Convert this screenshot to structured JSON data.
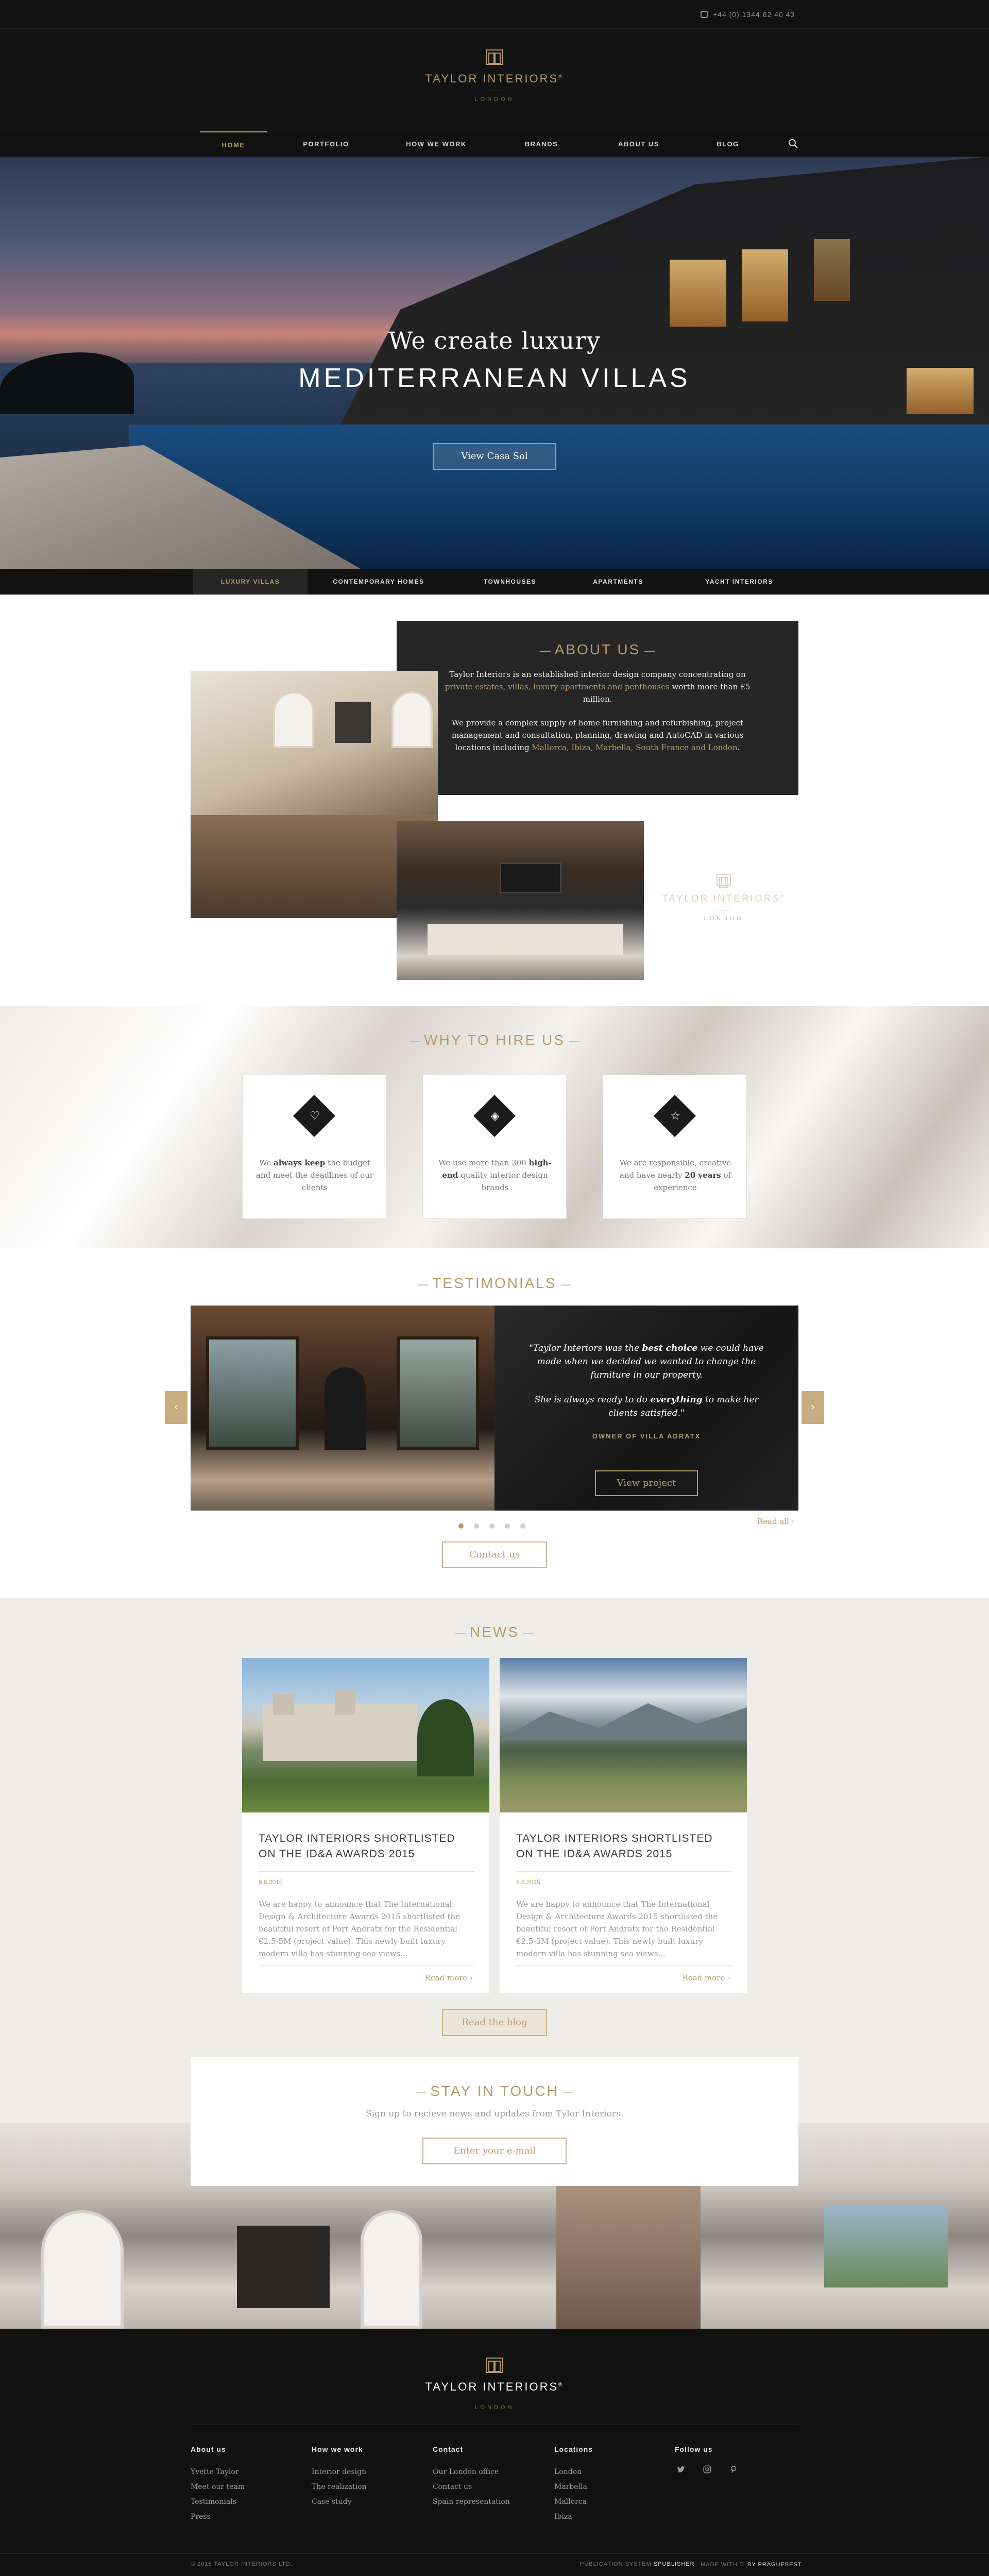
{
  "topbar": {
    "phone": "+44 (0) 1344 62 40 43"
  },
  "brand": {
    "name": "Taylor Interiors",
    "city": "LONDON",
    "reg": "®"
  },
  "nav": {
    "items": [
      "Home",
      "Portfolio",
      "How we work",
      "Brands",
      "About us",
      "Blog"
    ],
    "active": "Home",
    "search_icon": "search-icon"
  },
  "hero": {
    "title_line1": "We create luxury",
    "title_line2": "Mediterranean villas",
    "button": "View Casa Sol"
  },
  "categories": {
    "items": [
      "Luxury villas",
      "Contemporary homes",
      "Townhouses",
      "Apartments",
      "Yacht interiors"
    ],
    "active": "Luxury villas"
  },
  "about": {
    "title": "About us",
    "p1_a": "Taylor Interiors is an established interior design company concentrating on ",
    "p1_highlight": "private estates, villas, luxury apartments and penthouses",
    "p1_b": " worth more than £5 million.",
    "p2_a": "We provide a complex supply of home furnishing and refurbishing, project management and consultation, planning, drawing and AutoCAD in various locations including ",
    "p2_highlight": "Mallorca, Ibiza, Marbella, South France and London",
    "p2_b": "."
  },
  "why": {
    "title": "Why to hire us",
    "cards": [
      {
        "icon": "heart-icon",
        "glyph": "♡",
        "pre": "We ",
        "bold": "always keep",
        "post": " the budget and meet the deadlines of our clients"
      },
      {
        "icon": "diamond-icon",
        "glyph": "◈",
        "pre": "We use more than 300 ",
        "bold": "high-end",
        "post": " quality interior design brands"
      },
      {
        "icon": "star-icon",
        "glyph": "☆",
        "pre": "We are responsible, creative and have nearly ",
        "bold": "20 years",
        "post": " of experience"
      }
    ]
  },
  "testimonials": {
    "title": "Testimonials",
    "quote1_a": "\"Taylor Interiors was the ",
    "quote1_bold": "best choice",
    "quote1_b": " we could have made when we decided we wanted to change the furniture in our property.",
    "quote2_a": "She is always ready to do ",
    "quote2_bold": "everything",
    "quote2_b": " to make her clients satisfied.\"",
    "author": "Owner of villa Adratx",
    "button": "View project",
    "read_all": "Read all ›",
    "contact": "Contact us",
    "dots": 5,
    "active_dot": 1,
    "prev": "‹",
    "next": "›"
  },
  "news": {
    "title": "News",
    "items": [
      {
        "title": "Taylor interiors shortlisted on the ID&A Awards 2015",
        "date": "6.6.2015",
        "text": "We are happy to announce that The International Design & Architecture Awards 2015 shortlisted the beautiful resort of Port Andratx for the Residential €2.5-5M (project value). This newly built luxury modern villa has stunning sea views...",
        "more": "Read more ›"
      },
      {
        "title": "Taylor interiors shortlisted on the ID&A Awards 2015",
        "date": "6.6.2015",
        "text": "We are happy to announce that The International Design & Architecture Awards 2015 shortlisted the beautiful resort of Port Andratx for the Residential €2.5-5M (project value). This newly built luxury modern villa has stunning sea views...",
        "more": "Read more ›"
      }
    ],
    "blog_button": "Read the blog"
  },
  "stay": {
    "title": "Stay in touch",
    "subtitle": "Sign up to recieve news and updates from Tylor Interiors.",
    "placeholder": "Enter your e-mail"
  },
  "footer": {
    "columns": [
      {
        "title": "About us",
        "links": [
          "Yvette Taylor",
          "Meet our team",
          "Testimonials",
          "Press"
        ]
      },
      {
        "title": "How we work",
        "links": [
          "Interior design",
          "The realization",
          "Case study"
        ]
      },
      {
        "title": "Contact",
        "links": [
          "Our London office",
          "Contact us",
          "Spain representation"
        ]
      },
      {
        "title": "Locations",
        "links": [
          "London",
          "Marbella",
          "Mallorca",
          "Ibiza"
        ]
      }
    ],
    "follow_title": "Follow us",
    "social": [
      "twitter-icon",
      "instagram-icon",
      "pinterest-icon"
    ],
    "copyright": "© 2015 TAYLOR INTERIORS LTD.",
    "publication_label": "PUBLICATION SYSTEM ",
    "publication_name": "SPUBLISHER",
    "made_label": "MADE WITH ",
    "made_by": " BY PRAGUEBEST"
  },
  "colors": {
    "accent": "#b89b6a",
    "dark": "#111111",
    "panel": "#262626",
    "news_bg": "#efede9"
  }
}
